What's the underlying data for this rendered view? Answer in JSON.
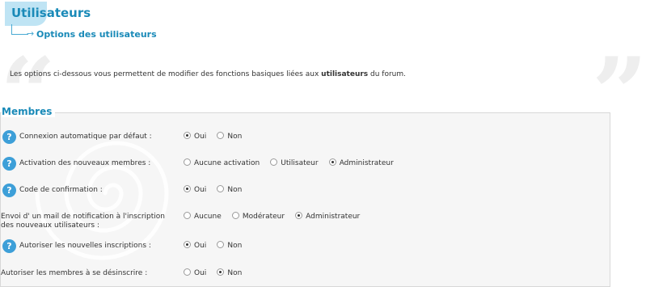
{
  "header": {
    "title": "Utilisateurs",
    "subtitle": "Options des utilisateurs"
  },
  "intro": {
    "before": "Les options ci-dessous vous permettent de modifier des fonctions basiques liées aux ",
    "bold": "utilisateurs",
    "after": " du forum."
  },
  "section": {
    "title": "Membres",
    "rows": [
      {
        "label": "Connexion automatique par défaut :",
        "has_help": true,
        "options": [
          {
            "label": "Oui",
            "checked": true
          },
          {
            "label": "Non",
            "checked": false
          }
        ]
      },
      {
        "label": "Activation des nouveaux membres :",
        "has_help": true,
        "options": [
          {
            "label": "Aucune activation",
            "checked": false
          },
          {
            "label": "Utilisateur",
            "checked": false
          },
          {
            "label": "Administrateur",
            "checked": true
          }
        ]
      },
      {
        "label": "Code de confirmation :",
        "has_help": true,
        "options": [
          {
            "label": "Oui",
            "checked": true
          },
          {
            "label": "Non",
            "checked": false
          }
        ]
      },
      {
        "label_line1": "Envoi d' un mail de notification à l'inscription",
        "label_line2": "des nouveaux utilisateurs :",
        "has_help": false,
        "options": [
          {
            "label": "Aucune",
            "checked": false
          },
          {
            "label": "Modérateur",
            "checked": false
          },
          {
            "label": "Administrateur",
            "checked": true
          }
        ]
      },
      {
        "label": "Autoriser les nouvelles inscriptions :",
        "has_help": true,
        "options": [
          {
            "label": "Oui",
            "checked": true
          },
          {
            "label": "Non",
            "checked": false
          }
        ]
      },
      {
        "label": "Autoriser les membres à se désinscrire :",
        "has_help": false,
        "options": [
          {
            "label": "Oui",
            "checked": false
          },
          {
            "label": "Non",
            "checked": true
          }
        ]
      }
    ]
  },
  "icons": {
    "help": "question-circle-icon",
    "help_glyph": "?",
    "quote_open": "“",
    "quote_close": "”"
  },
  "colors": {
    "accent": "#1a8ab8",
    "help_icon": "#3d9fd8",
    "fieldset_bg": "#f6f6f6"
  }
}
